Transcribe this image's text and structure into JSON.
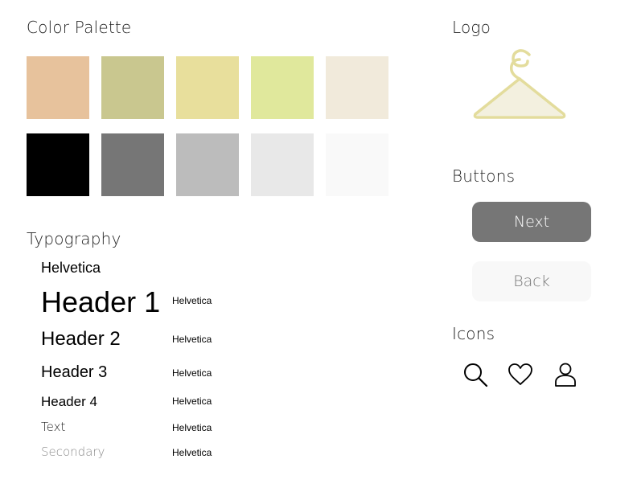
{
  "palette": {
    "title": "Color Palette",
    "row1": [
      "#e7c29c",
      "#c9c78f",
      "#e8df9c",
      "#e0e89c",
      "#f1eadb"
    ],
    "row2": [
      "#000000",
      "#767676",
      "#bcbcbc",
      "#e8e8e8",
      "#f9f9f9"
    ]
  },
  "typography": {
    "title": "Typography",
    "font_name": "Helvetica",
    "rows": [
      {
        "label": "Header 1",
        "font": "Helvetica"
      },
      {
        "label": "Header 2",
        "font": "Helvetica"
      },
      {
        "label": "Header 3",
        "font": "Helvetica"
      },
      {
        "label": "Header 4",
        "font": "Helvetica"
      },
      {
        "label": "Text",
        "font": "Helvetica"
      },
      {
        "label": "Secondary",
        "font": "Helvetica"
      }
    ]
  },
  "logo": {
    "title": "Logo",
    "icon": "hanger-icon",
    "color": "#e3dc9c"
  },
  "buttons": {
    "title": "Buttons",
    "next_label": "Next",
    "back_label": "Back",
    "primary_color": "#767676",
    "secondary_color": "#f8f8f8"
  },
  "icons": {
    "title": "Icons",
    "items": [
      "search-icon",
      "heart-icon",
      "user-icon"
    ]
  }
}
